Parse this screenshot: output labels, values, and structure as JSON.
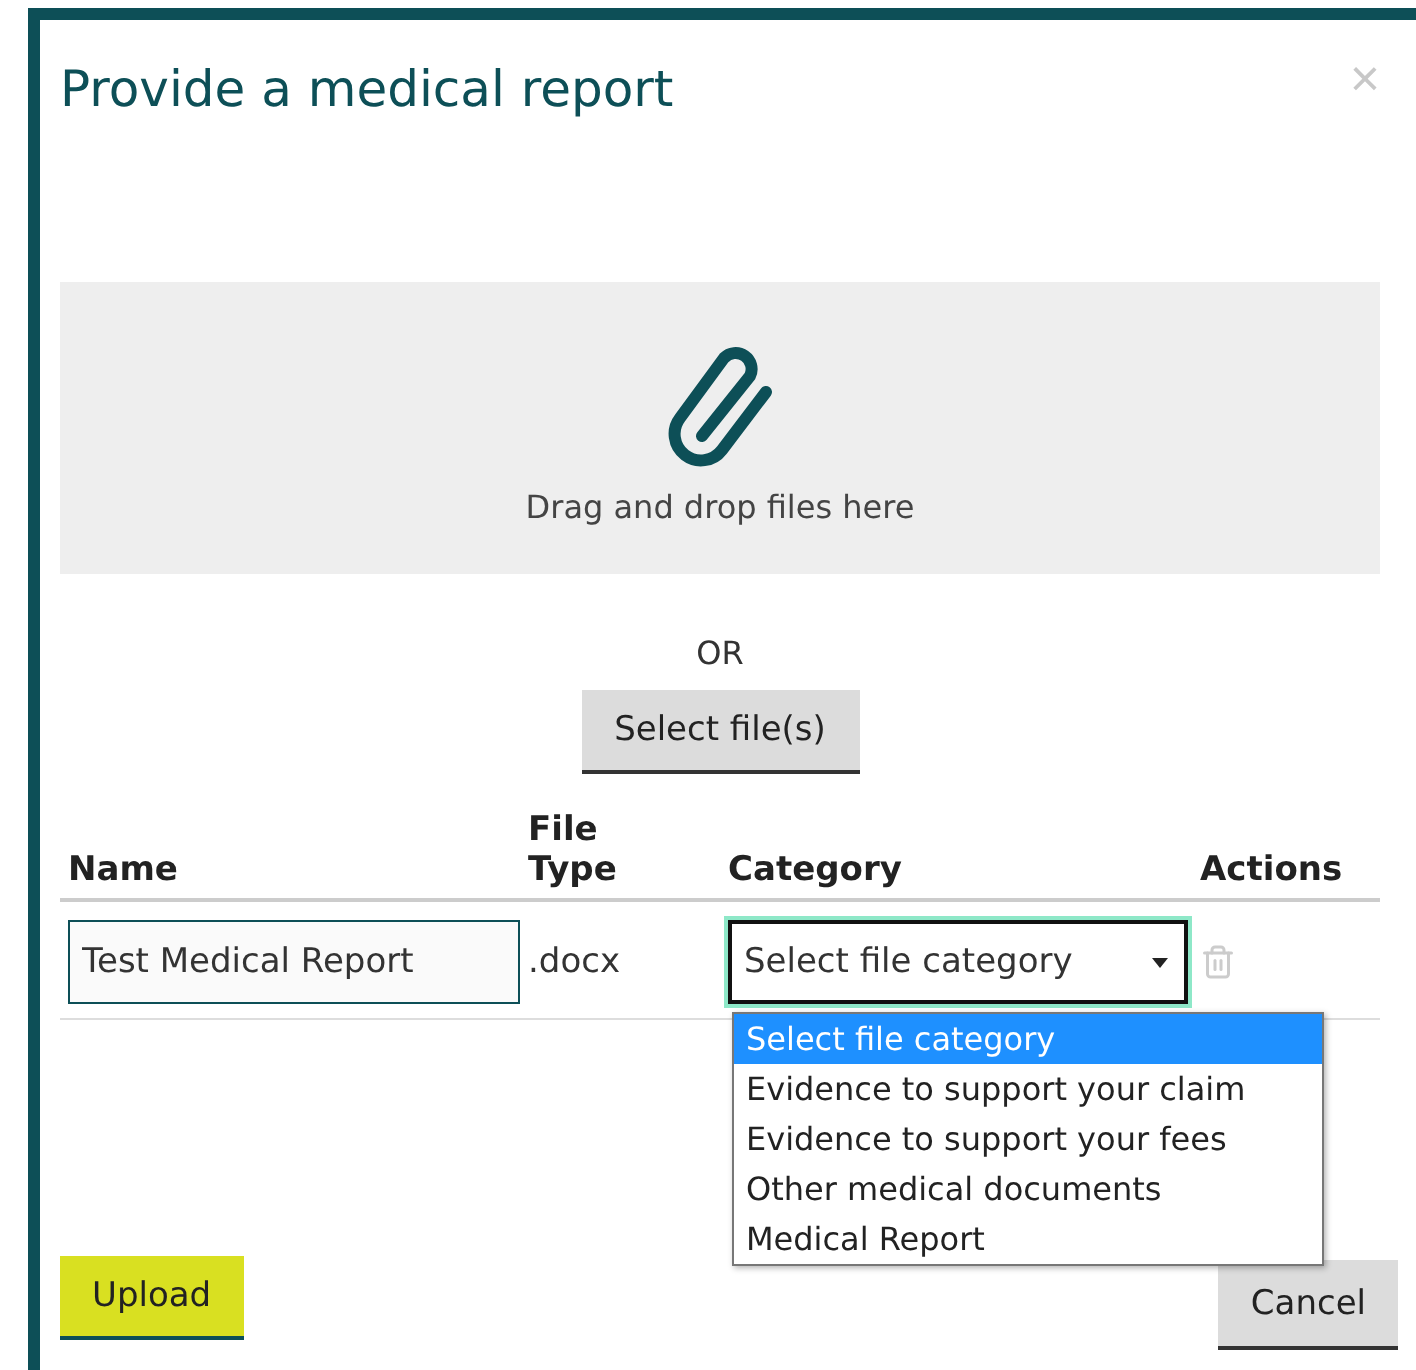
{
  "dialog": {
    "title": "Provide a medical report",
    "close": "×"
  },
  "dropzone": {
    "text": "Drag and drop files here"
  },
  "or_text": "OR",
  "select_button": "Select file(s)",
  "table": {
    "columns": [
      "Name",
      "File Type",
      "Category",
      "Actions"
    ],
    "rows": [
      {
        "name": "Test Medical Report",
        "file_type": ".docx",
        "category": "Select file category",
        "dropdown_open": true,
        "options": [
          {
            "label": "Select file category",
            "selected": true
          },
          {
            "label": "Evidence to support your claim",
            "selected": false
          },
          {
            "label": "Evidence to support your fees",
            "selected": false
          },
          {
            "label": "Other medical documents",
            "selected": false
          },
          {
            "label": "Medical Report",
            "selected": false
          }
        ]
      }
    ]
  },
  "buttons": [
    {
      "kind": "primary",
      "label": "Upload"
    },
    {
      "kind": "secondary",
      "label": "Cancel"
    }
  ]
}
